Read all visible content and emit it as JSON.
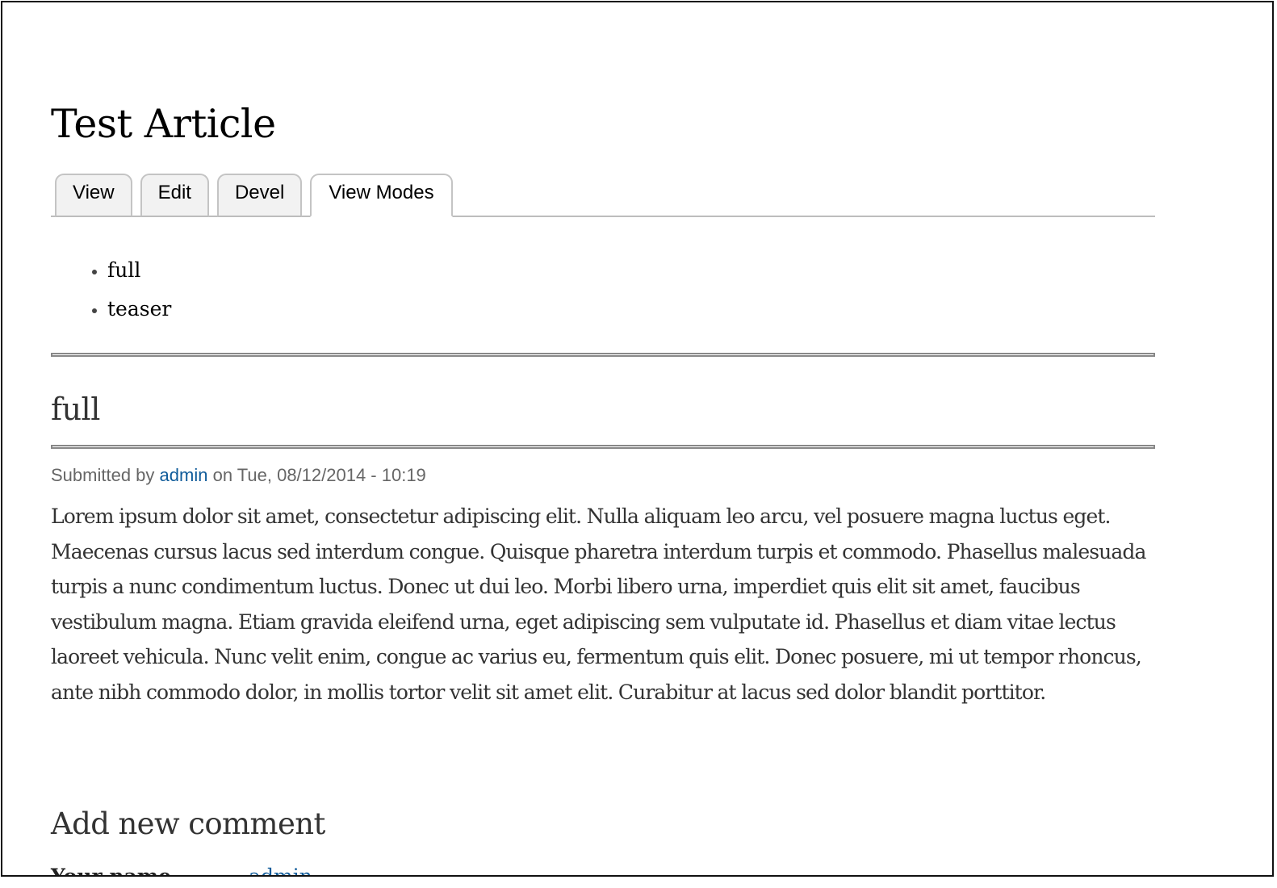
{
  "page": {
    "title": "Test Article"
  },
  "tabs": [
    {
      "label": "View",
      "active": false
    },
    {
      "label": "Edit",
      "active": false
    },
    {
      "label": "Devel",
      "active": false
    },
    {
      "label": "View Modes",
      "active": true
    }
  ],
  "view_modes": [
    "full",
    "teaser"
  ],
  "section": {
    "title": "full",
    "submitted_prefix": "Submitted by",
    "author": "admin",
    "submitted_suffix": "on Tue, 08/12/2014 - 10:19",
    "body": "Lorem ipsum dolor sit amet, consectetur adipiscing elit. Nulla aliquam leo arcu, vel posuere magna luctus eget. Maecenas cursus lacus sed interdum congue. Quisque pharetra interdum turpis et commodo. Phasellus malesuada turpis a nunc condimentum luctus. Donec ut dui leo. Morbi libero urna, imperdiet quis elit sit amet, faucibus vestibulum magna. Etiam gravida eleifend urna, eget adipiscing sem vulputate id. Phasellus et diam vitae lectus laoreet vehicula. Nunc velit enim, congue ac varius eu, fermentum quis elit. Donec posuere, mi ut tempor rhoncus, ante nibh commodo dolor, in mollis tortor velit sit amet elit. Curabitur at lacus sed dolor blandit porttitor."
  },
  "comment": {
    "title": "Add new comment",
    "name_label": "Your name",
    "name_value": "admin"
  },
  "colors": {
    "link": "#0f5b9a",
    "tab_bg": "#f2f2f2",
    "rule": "#888888"
  }
}
